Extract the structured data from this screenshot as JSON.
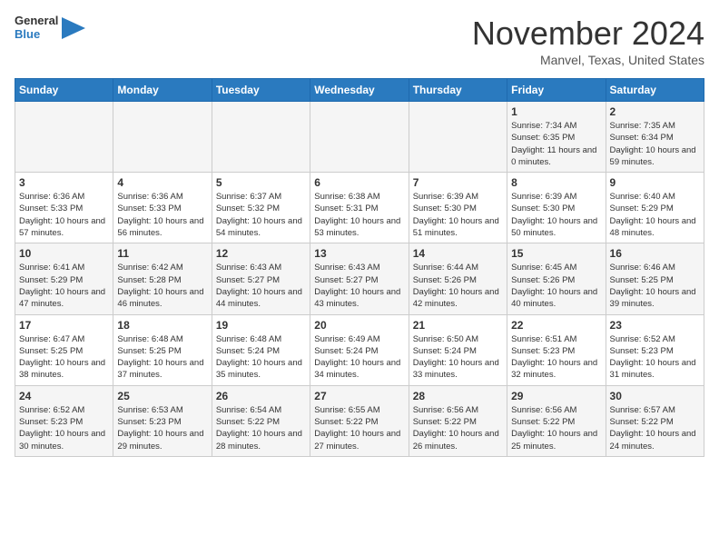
{
  "header": {
    "logo_general": "General",
    "logo_blue": "Blue",
    "month_title": "November 2024",
    "location": "Manvel, Texas, United States"
  },
  "weekdays": [
    "Sunday",
    "Monday",
    "Tuesday",
    "Wednesday",
    "Thursday",
    "Friday",
    "Saturday"
  ],
  "weeks": [
    [
      {
        "day": "",
        "info": ""
      },
      {
        "day": "",
        "info": ""
      },
      {
        "day": "",
        "info": ""
      },
      {
        "day": "",
        "info": ""
      },
      {
        "day": "",
        "info": ""
      },
      {
        "day": "1",
        "info": "Sunrise: 7:34 AM\nSunset: 6:35 PM\nDaylight: 11 hours and 0 minutes."
      },
      {
        "day": "2",
        "info": "Sunrise: 7:35 AM\nSunset: 6:34 PM\nDaylight: 10 hours and 59 minutes."
      }
    ],
    [
      {
        "day": "3",
        "info": "Sunrise: 6:36 AM\nSunset: 5:33 PM\nDaylight: 10 hours and 57 minutes."
      },
      {
        "day": "4",
        "info": "Sunrise: 6:36 AM\nSunset: 5:33 PM\nDaylight: 10 hours and 56 minutes."
      },
      {
        "day": "5",
        "info": "Sunrise: 6:37 AM\nSunset: 5:32 PM\nDaylight: 10 hours and 54 minutes."
      },
      {
        "day": "6",
        "info": "Sunrise: 6:38 AM\nSunset: 5:31 PM\nDaylight: 10 hours and 53 minutes."
      },
      {
        "day": "7",
        "info": "Sunrise: 6:39 AM\nSunset: 5:30 PM\nDaylight: 10 hours and 51 minutes."
      },
      {
        "day": "8",
        "info": "Sunrise: 6:39 AM\nSunset: 5:30 PM\nDaylight: 10 hours and 50 minutes."
      },
      {
        "day": "9",
        "info": "Sunrise: 6:40 AM\nSunset: 5:29 PM\nDaylight: 10 hours and 48 minutes."
      }
    ],
    [
      {
        "day": "10",
        "info": "Sunrise: 6:41 AM\nSunset: 5:29 PM\nDaylight: 10 hours and 47 minutes."
      },
      {
        "day": "11",
        "info": "Sunrise: 6:42 AM\nSunset: 5:28 PM\nDaylight: 10 hours and 46 minutes."
      },
      {
        "day": "12",
        "info": "Sunrise: 6:43 AM\nSunset: 5:27 PM\nDaylight: 10 hours and 44 minutes."
      },
      {
        "day": "13",
        "info": "Sunrise: 6:43 AM\nSunset: 5:27 PM\nDaylight: 10 hours and 43 minutes."
      },
      {
        "day": "14",
        "info": "Sunrise: 6:44 AM\nSunset: 5:26 PM\nDaylight: 10 hours and 42 minutes."
      },
      {
        "day": "15",
        "info": "Sunrise: 6:45 AM\nSunset: 5:26 PM\nDaylight: 10 hours and 40 minutes."
      },
      {
        "day": "16",
        "info": "Sunrise: 6:46 AM\nSunset: 5:25 PM\nDaylight: 10 hours and 39 minutes."
      }
    ],
    [
      {
        "day": "17",
        "info": "Sunrise: 6:47 AM\nSunset: 5:25 PM\nDaylight: 10 hours and 38 minutes."
      },
      {
        "day": "18",
        "info": "Sunrise: 6:48 AM\nSunset: 5:25 PM\nDaylight: 10 hours and 37 minutes."
      },
      {
        "day": "19",
        "info": "Sunrise: 6:48 AM\nSunset: 5:24 PM\nDaylight: 10 hours and 35 minutes."
      },
      {
        "day": "20",
        "info": "Sunrise: 6:49 AM\nSunset: 5:24 PM\nDaylight: 10 hours and 34 minutes."
      },
      {
        "day": "21",
        "info": "Sunrise: 6:50 AM\nSunset: 5:24 PM\nDaylight: 10 hours and 33 minutes."
      },
      {
        "day": "22",
        "info": "Sunrise: 6:51 AM\nSunset: 5:23 PM\nDaylight: 10 hours and 32 minutes."
      },
      {
        "day": "23",
        "info": "Sunrise: 6:52 AM\nSunset: 5:23 PM\nDaylight: 10 hours and 31 minutes."
      }
    ],
    [
      {
        "day": "24",
        "info": "Sunrise: 6:52 AM\nSunset: 5:23 PM\nDaylight: 10 hours and 30 minutes."
      },
      {
        "day": "25",
        "info": "Sunrise: 6:53 AM\nSunset: 5:23 PM\nDaylight: 10 hours and 29 minutes."
      },
      {
        "day": "26",
        "info": "Sunrise: 6:54 AM\nSunset: 5:22 PM\nDaylight: 10 hours and 28 minutes."
      },
      {
        "day": "27",
        "info": "Sunrise: 6:55 AM\nSunset: 5:22 PM\nDaylight: 10 hours and 27 minutes."
      },
      {
        "day": "28",
        "info": "Sunrise: 6:56 AM\nSunset: 5:22 PM\nDaylight: 10 hours and 26 minutes."
      },
      {
        "day": "29",
        "info": "Sunrise: 6:56 AM\nSunset: 5:22 PM\nDaylight: 10 hours and 25 minutes."
      },
      {
        "day": "30",
        "info": "Sunrise: 6:57 AM\nSunset: 5:22 PM\nDaylight: 10 hours and 24 minutes."
      }
    ]
  ]
}
